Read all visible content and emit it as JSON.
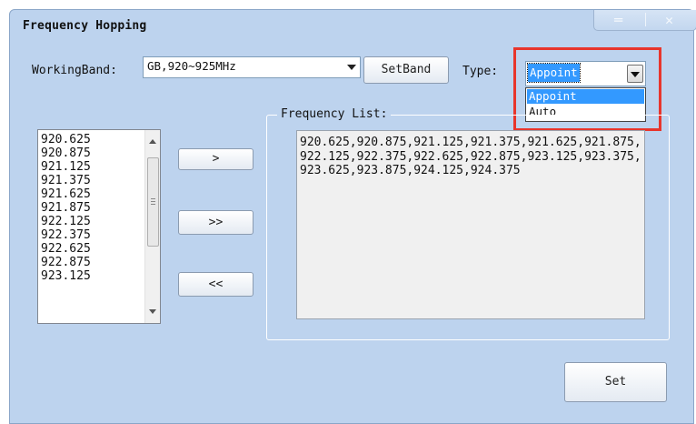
{
  "window": {
    "title": "Frequency Hopping",
    "minimize_glyph": "═",
    "close_glyph": "✕"
  },
  "working_band": {
    "label": "WorkingBand:",
    "value": "GB,920~925MHz"
  },
  "buttons": {
    "set_band": "SetBand",
    "move_one": ">",
    "move_all": ">>",
    "remove_all": "<<",
    "set": "Set"
  },
  "type": {
    "label": "Type:",
    "value": "Appoint",
    "options": [
      "Appoint",
      "Auto"
    ],
    "selected_index": 0
  },
  "available_list": [
    "920.625",
    "920.875",
    "921.125",
    "921.375",
    "921.625",
    "921.875",
    "922.125",
    "922.375",
    "922.625",
    "922.875",
    "923.125"
  ],
  "frequency_list": {
    "title": "Frequency List:",
    "text": "920.625,920.875,921.125,921.375,921.625,921.875,922.125,922.375,922.625,922.875,923.125,923.375,923.625,923.875,924.125,924.375"
  },
  "colors": {
    "window_bg": "#bdd3ee",
    "highlight": "#e8352c",
    "selected": "#3399ff"
  }
}
